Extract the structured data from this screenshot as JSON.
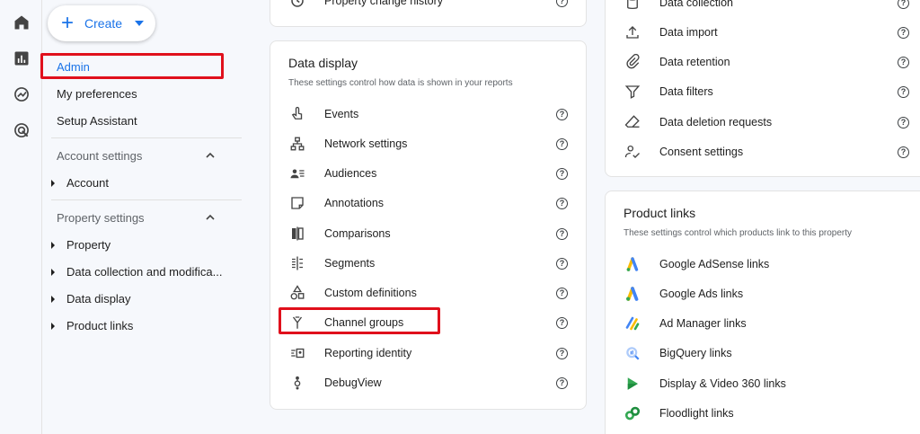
{
  "create": {
    "label": "Create"
  },
  "nav": {
    "top_items": [
      "Admin",
      "My preferences",
      "Setup Assistant"
    ],
    "account_section": {
      "title": "Account settings",
      "items": [
        "Account"
      ]
    },
    "property_section": {
      "title": "Property settings",
      "items": [
        "Property",
        "Data collection and modifica...",
        "Data display",
        "Product links"
      ]
    }
  },
  "top_middle": {
    "label": "Property change history"
  },
  "data_display": {
    "title": "Data display",
    "subtitle": "These settings control how data is shown in your reports",
    "items": [
      "Events",
      "Network settings",
      "Audiences",
      "Annotations",
      "Comparisons",
      "Segments",
      "Custom definitions",
      "Channel groups",
      "Reporting identity",
      "DebugView"
    ]
  },
  "data_collection": {
    "items": [
      "Data collection",
      "Data import",
      "Data retention",
      "Data filters",
      "Data deletion requests",
      "Consent settings"
    ]
  },
  "product_links": {
    "title": "Product links",
    "subtitle": "These settings control which products link to this property",
    "items": [
      "Google AdSense links",
      "Google Ads links",
      "Ad Manager links",
      "BigQuery links",
      "Display & Video 360 links",
      "Floodlight links"
    ]
  },
  "colors": {
    "accent": "#1a73e8",
    "highlight": "#e0101c"
  }
}
